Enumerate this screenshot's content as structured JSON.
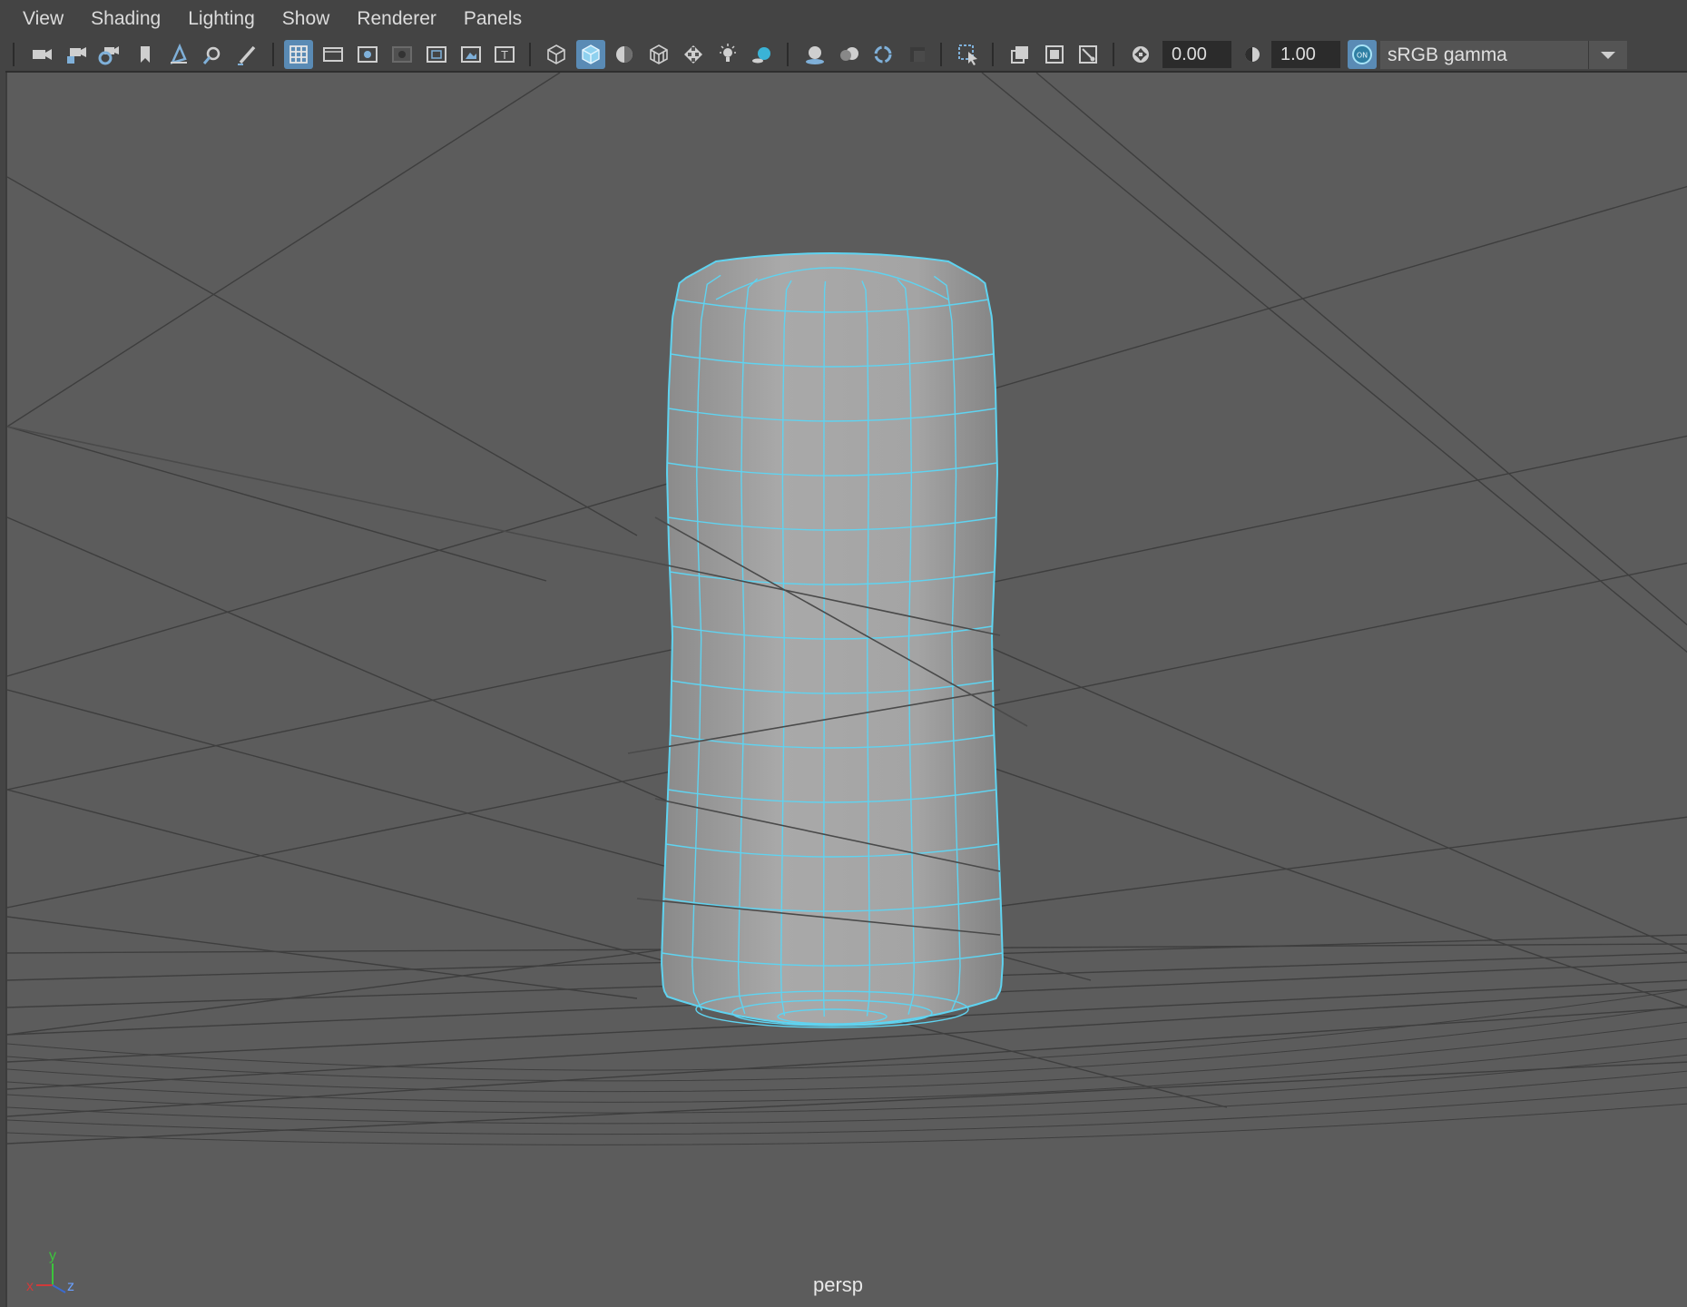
{
  "menu": [
    "View",
    "Shading",
    "Lighting",
    "Show",
    "Renderer",
    "Panels"
  ],
  "toolbar": {
    "exposure_value": "0.00",
    "gamma_value": "1.00",
    "color_management_toggle": "ON",
    "color_space": "sRGB gamma",
    "active_tools": [
      "grid",
      "smooth-shade-all"
    ]
  },
  "viewport": {
    "camera_label": "persp",
    "axis_labels": {
      "x": "x",
      "y": "y",
      "z": "z"
    },
    "colors": {
      "background": "#5c5c5c",
      "grid_line": "#3e3e3e",
      "wireframe_highlight": "#5fd3f0",
      "mesh_shading": "#a8a8a8"
    }
  }
}
